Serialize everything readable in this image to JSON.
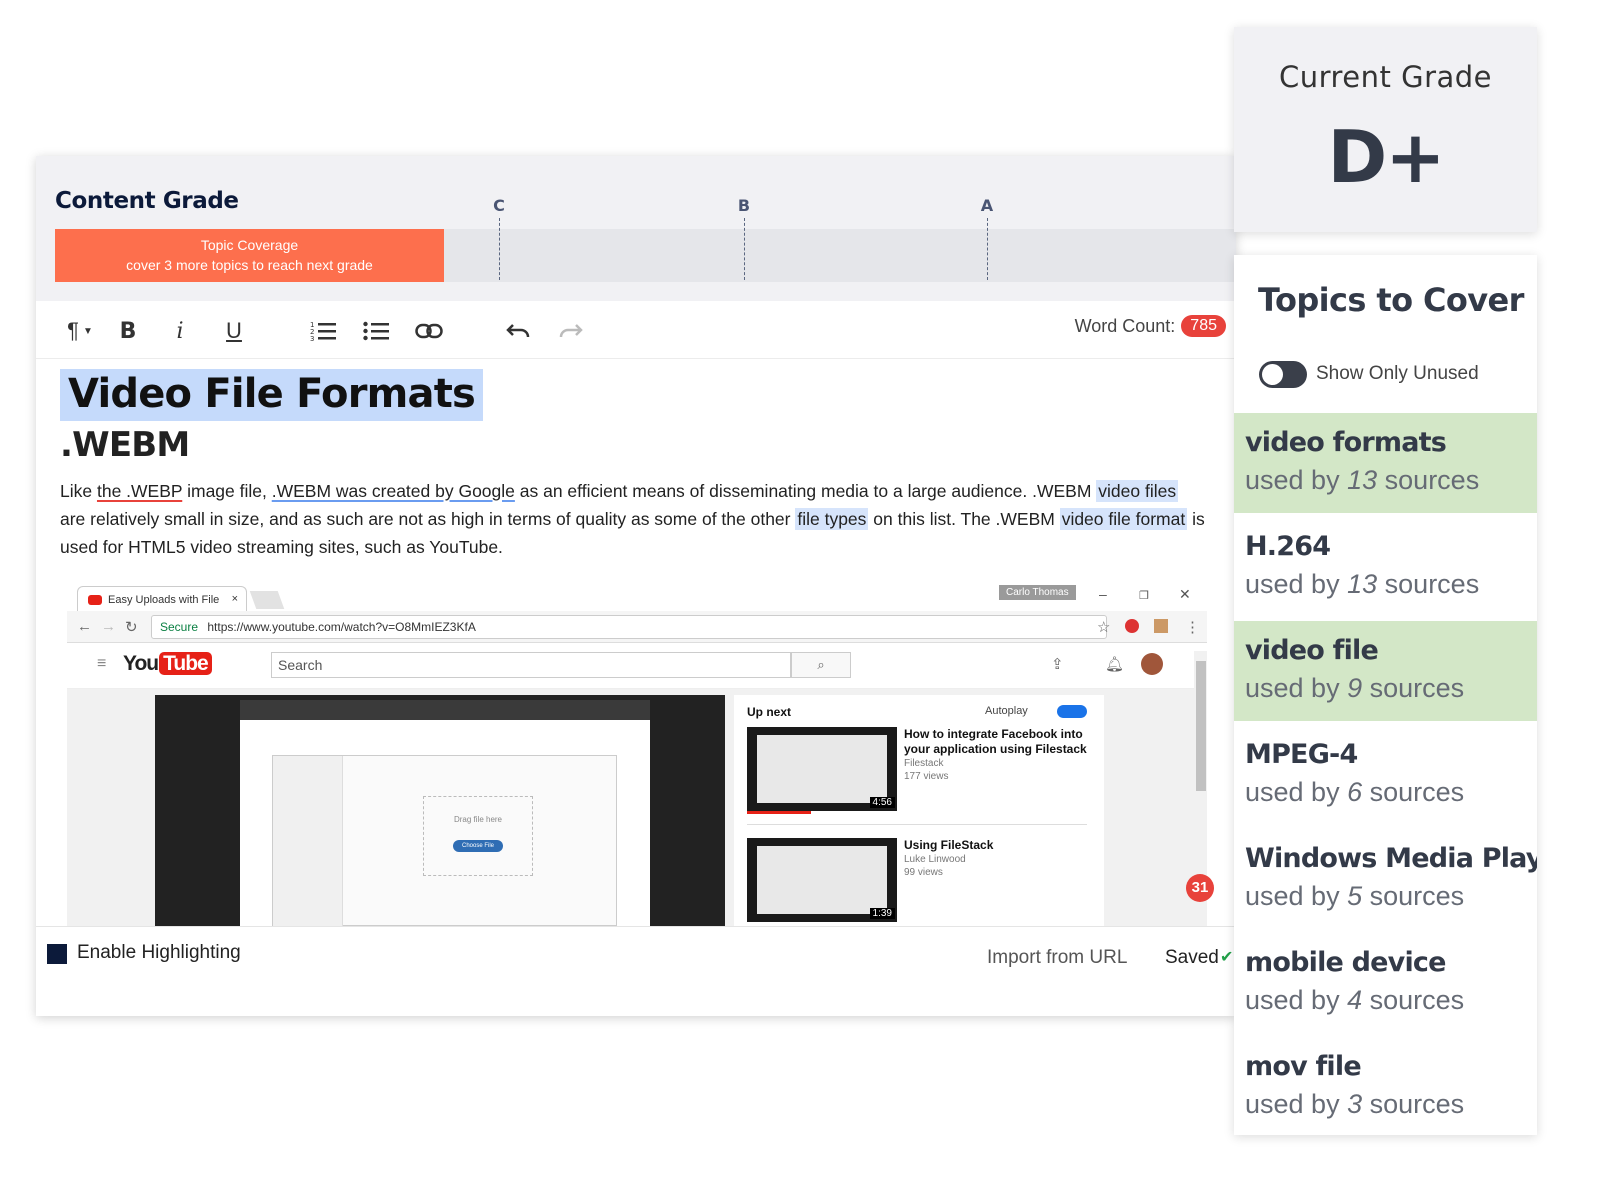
{
  "content_grade": {
    "title": "Content Grade",
    "marks": [
      "C",
      "B",
      "A"
    ],
    "coverage_bar": {
      "line1": "Topic Coverage",
      "line2": "cover 3 more topics to reach next grade",
      "color": "#fd6f4d"
    }
  },
  "toolbar": {
    "paragraph_icon": "¶",
    "bold_icon": "B",
    "italic_icon": "i",
    "underline_icon": "U",
    "word_count_label": "Word Count:",
    "word_count_value": "785"
  },
  "document": {
    "h1": "Video File Formats",
    "h2": ".WEBM",
    "p_parts": {
      "t1": "Like ",
      "t2": "the .WEBP",
      "t3": " image file, ",
      "t4": ".WEBM was created by Google",
      "t5": " as an efficient means of disseminating media to a large audience. .WEBM ",
      "t6": "video files",
      "t7": " are relatively small in size, and as such are not as high in terms of quality as some of the other ",
      "t8": "file types",
      "t9": " on this list. The .WEBM ",
      "t10": "video file format",
      "t11": " is used for HTML5 video streaming sites, such as YouTube."
    }
  },
  "embed": {
    "tab_title": "Easy Uploads with File",
    "user_chip": "Carlo Thomas",
    "secure": "Secure",
    "url": "https://www.youtube.com/watch?v=O8MmIEZ3KfA",
    "yt_logo_you": "You",
    "yt_logo_tube": "Tube",
    "search_placeholder": "Search",
    "drag_text": "Drag file here",
    "choose_file": "Choose File",
    "up_next": "Up next",
    "autoplay": "Autoplay",
    "videos": [
      {
        "title": "How to integrate Facebook into your application using Filestack",
        "channel": "Filestack",
        "views": "177 views",
        "duration": "4:56"
      },
      {
        "title": "Using FileStack",
        "channel": "Luke Linwood",
        "views": "99 views",
        "duration": "1:39"
      }
    ],
    "notif_count": "31"
  },
  "footer": {
    "enable_highlighting": "Enable Highlighting",
    "import_url": "Import from URL",
    "saved": "Saved"
  },
  "grade_card": {
    "label": "Current Grade",
    "value": "D+"
  },
  "topics": {
    "title": "Topics to Cover",
    "toggle_label": "Show Only Unused",
    "used_prefix": "used by",
    "sources_suffix": "sources",
    "used_color": "#d3e7c7",
    "items": [
      {
        "name": "video formats",
        "count": "13",
        "used": true
      },
      {
        "name": "H.264",
        "count": "13",
        "used": false
      },
      {
        "name": "video file",
        "count": "9",
        "used": true
      },
      {
        "name": "MPEG-4",
        "count": "6",
        "used": false
      },
      {
        "name": "Windows Media Player",
        "count": "5",
        "used": false
      },
      {
        "name": "mobile device",
        "count": "4",
        "used": false
      },
      {
        "name": "mov file",
        "count": "3",
        "used": false
      }
    ]
  }
}
